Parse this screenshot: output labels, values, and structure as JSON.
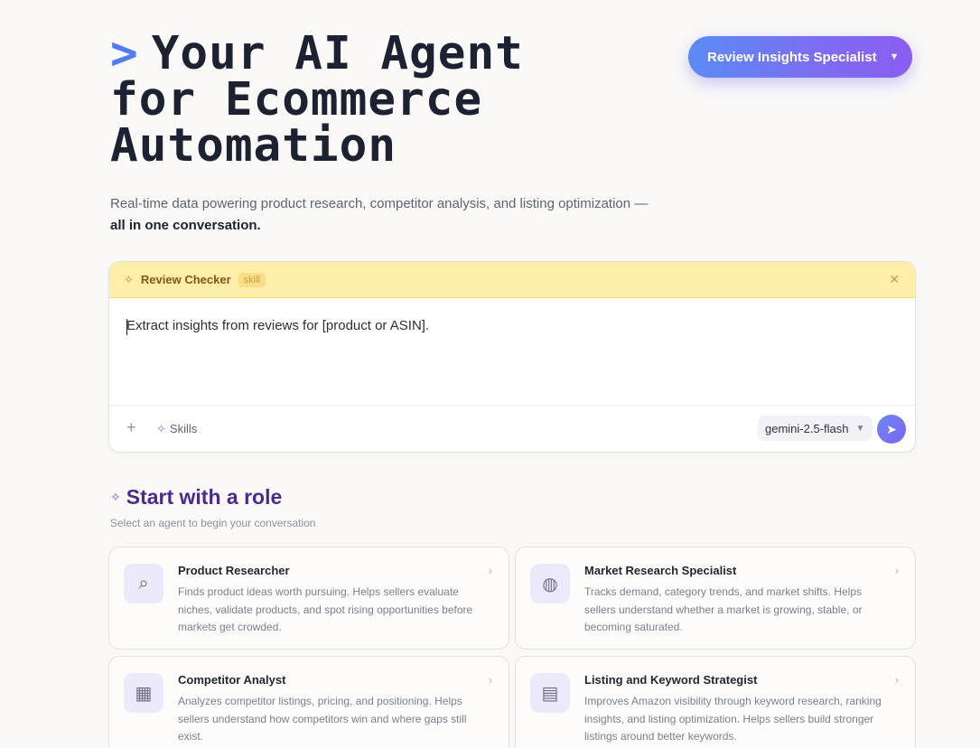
{
  "hero": {
    "caret": ">",
    "line1": "Your AI Agent",
    "line2": "for Ecommerce",
    "line3": "Automation"
  },
  "subtitle": {
    "text": "Real-time data powering product research, competitor analysis, and listing optimization —",
    "emphasis": "all in one conversation."
  },
  "role_selector": {
    "label": "Review Insights Specialist",
    "icon": "chevron-down-icon"
  },
  "composer": {
    "skill_name": "Review Checker",
    "skill_tag": "skill",
    "prompt": "Extract insights from reviews for [product or ASIN].",
    "skills_label": "Skills",
    "model": "gemini-2.5-flash"
  },
  "roles_section": {
    "title": "Start with a role",
    "subtitle": "Select an agent to begin your conversation",
    "cards": [
      {
        "title": "Product Researcher",
        "description": "Finds product ideas worth pursuing. Helps sellers evaluate niches, validate products, and spot rising opportunities before markets get crowded.",
        "icon": "package-search-icon"
      },
      {
        "title": "Market Research Specialist",
        "description": "Tracks demand, category trends, and market shifts. Helps sellers understand whether a market is growing, stable, or becoming saturated.",
        "icon": "globe-icon"
      },
      {
        "title": "Competitor Analyst",
        "description": "Analyzes competitor listings, pricing, and positioning. Helps sellers understand how competitors win and where gaps still exist.",
        "icon": "storefront-icon"
      },
      {
        "title": "Listing and Keyword Strategist",
        "description": "Improves Amazon visibility through keyword research, ranking insights, and listing optimization. Helps sellers build stronger listings around better keywords.",
        "icon": "document-search-icon"
      }
    ]
  },
  "colors": {
    "accent": "#4f7cf0",
    "brand_purple": "#4a2a8c",
    "skill_bar": "#fdeeaa"
  }
}
